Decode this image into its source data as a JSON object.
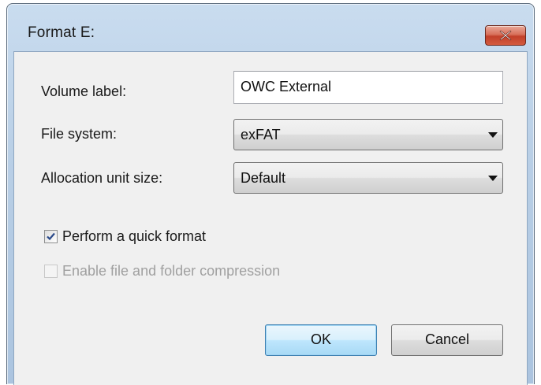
{
  "window": {
    "title": "Format E:",
    "close_icon": "close-x-icon"
  },
  "form": {
    "volume_label": {
      "label": "Volume label:",
      "value": "OWC External"
    },
    "file_system": {
      "label": "File system:",
      "selected": "exFAT"
    },
    "allocation_unit_size": {
      "label": "Allocation unit size:",
      "selected": "Default"
    },
    "quick_format": {
      "label": "Perform a quick format",
      "checked": true,
      "enabled": true
    },
    "compression": {
      "label": "Enable file and folder compression",
      "checked": false,
      "enabled": false
    }
  },
  "buttons": {
    "ok": "OK",
    "cancel": "Cancel"
  },
  "colors": {
    "frame": "#b9cfe6",
    "close_button": "#c2402a",
    "client_background": "#f0f0f0",
    "default_button": "#3c7fb1"
  }
}
